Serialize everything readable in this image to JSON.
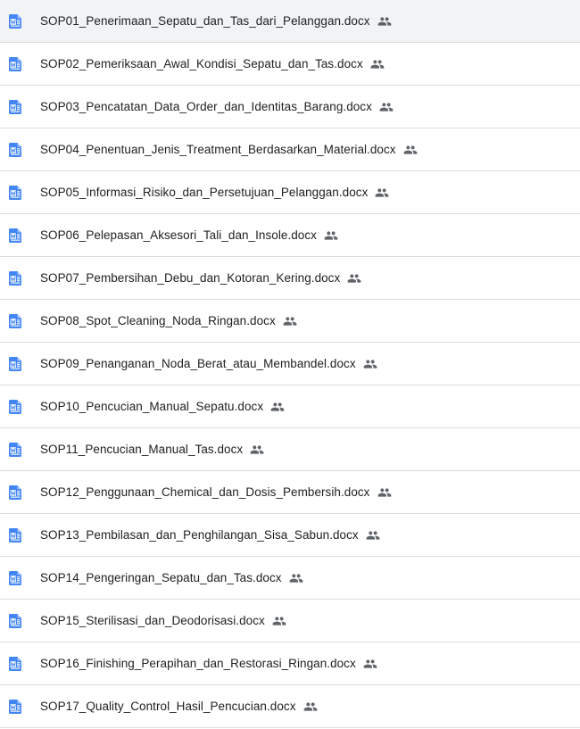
{
  "colors": {
    "doc_icon_blue": "#4285f4",
    "shared_icon_gray": "#5f6368",
    "text": "#202124",
    "divider": "#dadce0"
  },
  "icons": {
    "file_type": "word-doc-icon",
    "shared": "shared-people-icon"
  },
  "files": [
    {
      "name": "SOP01_Penerimaan_Sepatu_dan_Tas_dari_Pelanggan.docx",
      "shared": true
    },
    {
      "name": "SOP02_Pemeriksaan_Awal_Kondisi_Sepatu_dan_Tas.docx",
      "shared": true
    },
    {
      "name": "SOP03_Pencatatan_Data_Order_dan_Identitas_Barang.docx",
      "shared": true
    },
    {
      "name": "SOP04_Penentuan_Jenis_Treatment_Berdasarkan_Material.docx",
      "shared": true
    },
    {
      "name": "SOP05_Informasi_Risiko_dan_Persetujuan_Pelanggan.docx",
      "shared": true
    },
    {
      "name": "SOP06_Pelepasan_Aksesori_Tali_dan_Insole.docx",
      "shared": true
    },
    {
      "name": "SOP07_Pembersihan_Debu_dan_Kotoran_Kering.docx",
      "shared": true
    },
    {
      "name": "SOP08_Spot_Cleaning_Noda_Ringan.docx",
      "shared": true
    },
    {
      "name": "SOP09_Penanganan_Noda_Berat_atau_Membandel.docx",
      "shared": true
    },
    {
      "name": "SOP10_Pencucian_Manual_Sepatu.docx",
      "shared": true
    },
    {
      "name": "SOP11_Pencucian_Manual_Tas.docx",
      "shared": true
    },
    {
      "name": "SOP12_Penggunaan_Chemical_dan_Dosis_Pembersih.docx",
      "shared": true
    },
    {
      "name": "SOP13_Pembilasan_dan_Penghilangan_Sisa_Sabun.docx",
      "shared": true
    },
    {
      "name": "SOP14_Pengeringan_Sepatu_dan_Tas.docx",
      "shared": true
    },
    {
      "name": "SOP15_Sterilisasi_dan_Deodorisasi.docx",
      "shared": true
    },
    {
      "name": "SOP16_Finishing_Perapihan_dan_Restorasi_Ringan.docx",
      "shared": true
    },
    {
      "name": "SOP17_Quality_Control_Hasil_Pencucian.docx",
      "shared": true
    }
  ]
}
